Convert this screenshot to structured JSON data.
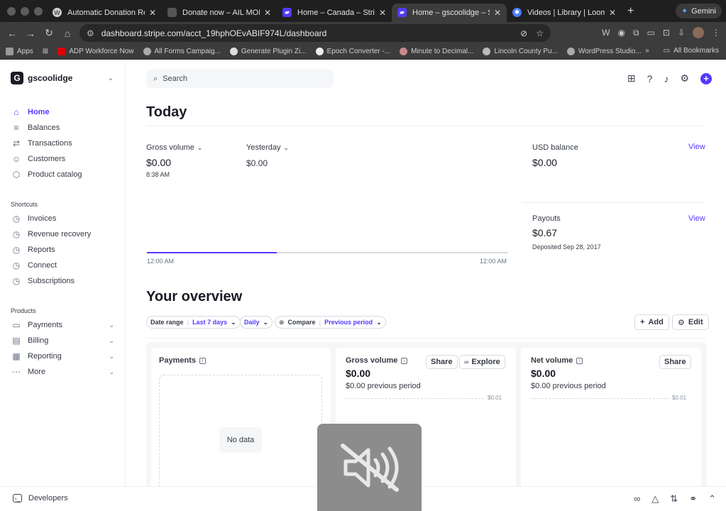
{
  "browser": {
    "tabs": [
      {
        "title": "Automatic Donation Receip",
        "active": false,
        "favicon_color": "#3a3a3a"
      },
      {
        "title": "Donate now – AIL MODENA",
        "active": false,
        "favicon_color": "#2a2a2a"
      },
      {
        "title": "Home – Canada – Stripe [T",
        "active": false,
        "favicon_color": "#533afd"
      },
      {
        "title": "Home – gscoolidge – Stripe",
        "active": true,
        "favicon_color": "#533afd"
      },
      {
        "title": "Videos | Library | Loom",
        "active": false,
        "favicon_color": "#4a7cff"
      }
    ],
    "gemini_label": "Gemini",
    "url": "dashboard.stripe.com/acct_19hphOEvABIF974L/dashboard",
    "bookmarks": [
      {
        "label": "Apps"
      },
      {
        "label": "ADP Workforce Now"
      },
      {
        "label": "All Forms Campaig..."
      },
      {
        "label": "Generate Plugin Zi..."
      },
      {
        "label": "Epoch Converter -..."
      },
      {
        "label": "Minute to Decimal..."
      },
      {
        "label": "Lincoln County Pu..."
      },
      {
        "label": "WordPress Studio..."
      }
    ],
    "all_bookmarks_label": "All Bookmarks"
  },
  "sidebar": {
    "account_name": "gscoolidge",
    "account_initial": "G",
    "primary": [
      {
        "label": "Home",
        "icon": "home-icon"
      },
      {
        "label": "Balances",
        "icon": "balances-icon"
      },
      {
        "label": "Transactions",
        "icon": "transactions-icon"
      },
      {
        "label": "Customers",
        "icon": "customers-icon"
      },
      {
        "label": "Product catalog",
        "icon": "product-catalog-icon"
      }
    ],
    "shortcuts_label": "Shortcuts",
    "shortcuts": [
      {
        "label": "Invoices"
      },
      {
        "label": "Revenue recovery"
      },
      {
        "label": "Reports"
      },
      {
        "label": "Connect"
      },
      {
        "label": "Subscriptions"
      }
    ],
    "products_label": "Products",
    "products": [
      {
        "label": "Payments"
      },
      {
        "label": "Billing"
      },
      {
        "label": "Reporting"
      },
      {
        "label": "More"
      }
    ]
  },
  "header": {
    "search_placeholder": "Search"
  },
  "today": {
    "title": "Today",
    "gross_volume_label": "Gross volume",
    "gross_volume_value": "$0.00",
    "gross_volume_time": "8:38 AM",
    "yesterday_label": "Yesterday",
    "yesterday_value": "$0.00",
    "axis_start": "12:00 AM",
    "axis_end": "12:00 AM",
    "day_progress": 0.36,
    "usd_balance_label": "USD balance",
    "usd_balance_value": "$0.00",
    "usd_balance_link": "View",
    "payouts_label": "Payouts",
    "payouts_value": "$0.67",
    "payouts_sub": "Deposited Sep 28, 2017",
    "payouts_link": "View"
  },
  "overview": {
    "title": "Your overview",
    "date_range_label": "Date range",
    "date_range_value": "Last 7 days",
    "interval_value": "Daily",
    "compare_label": "Compare",
    "compare_value": "Previous period",
    "add_label": "Add",
    "edit_label": "Edit",
    "cards": {
      "payments": {
        "title": "Payments",
        "empty": "No data"
      },
      "gross": {
        "title": "Gross volume",
        "value": "$0.00",
        "sub": "$0.00 previous period",
        "share": "Share",
        "explore": "Explore",
        "tick": "$0.01"
      },
      "net": {
        "title": "Net volume",
        "value": "$0.00",
        "sub": "$0.00 previous period",
        "share": "Share",
        "tick": "$0.01"
      }
    }
  },
  "footer": {
    "developers_label": "Developers"
  },
  "colors": {
    "accent": "#533afd"
  }
}
